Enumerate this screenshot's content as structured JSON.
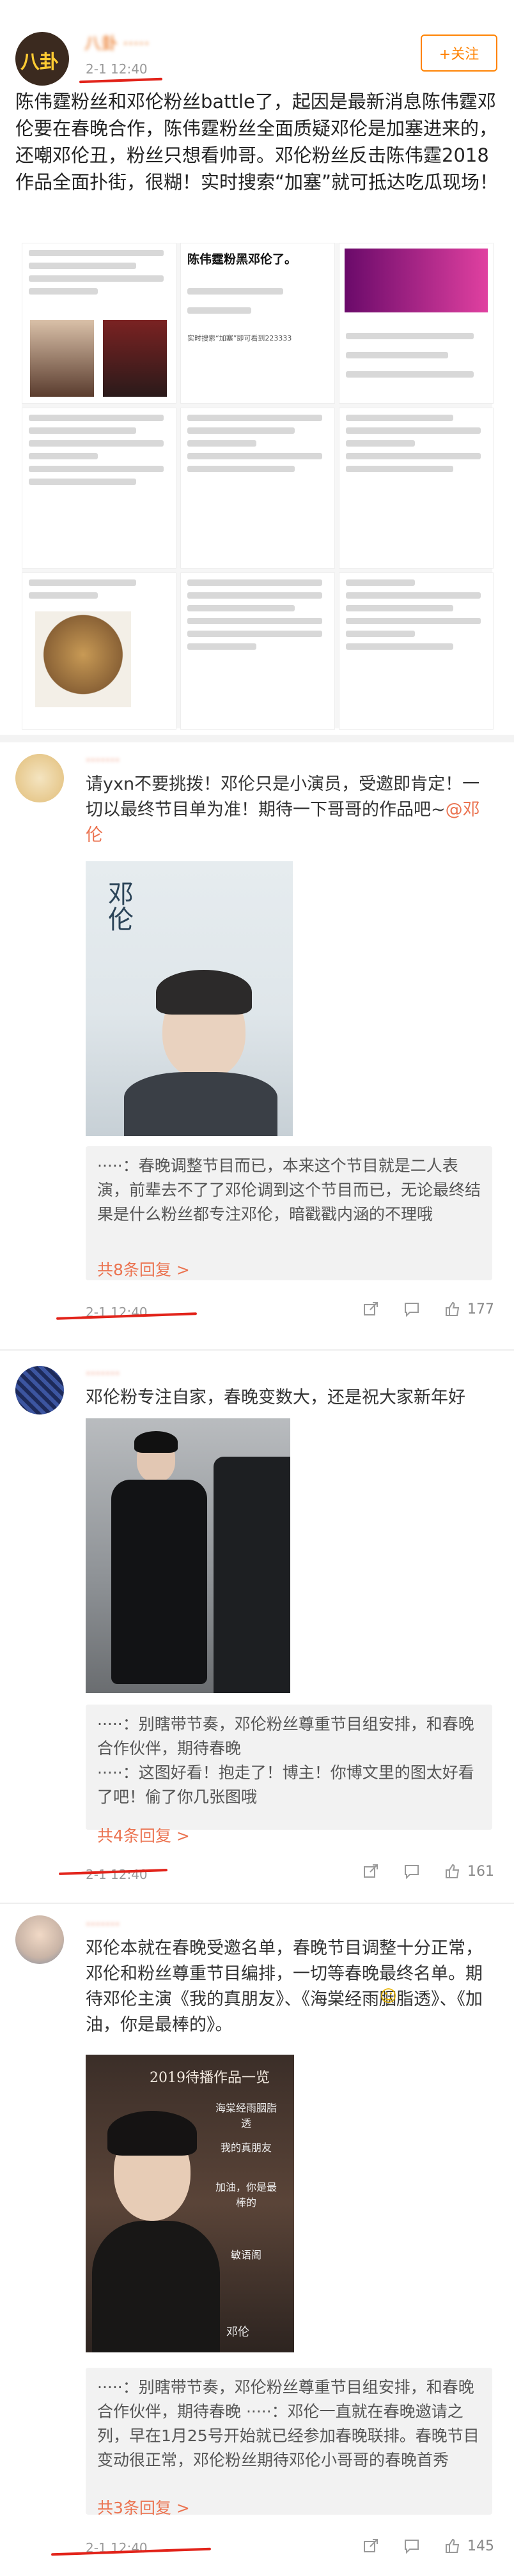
{
  "post": {
    "author_name": "八卦 ·····",
    "avatar_text": "八卦",
    "follow_label": "+关注",
    "time": "2-1 12:40",
    "text": "陈伟霆粉丝和邓伦粉丝battle了，起因是最新消息陈伟霆邓伦要在春晚合作，陈伟霆粉丝全面质疑邓伦是加塞进来的，还嘲邓伦丑，粉丝只想看帅哥。邓伦粉丝反击陈伟霆2018作品全面扑街，很糊！实时搜索“加塞”就可抵达吃瓜现场！",
    "collage": {
      "headline": "陈伟霆粉黑邓伦了。",
      "search_text": "实时搜索“加塞”即可看到223333",
      "mini_title": "陈伟霆粉黑邓伦了。"
    }
  },
  "comments": [
    {
      "name": "·······",
      "text_parts": [
        "请yxn不要挑拨！邓伦只是小演员，受邀即肯定！一切以最终节目单为准！期待一下哥哥的作品吧~",
        "@邓伦"
      ],
      "poster_label": "邓伦",
      "reply_text": "·····：春晚调整节目而已，本来这个节目就是二人表演，前辈去不了了邓伦调到这个节目而已，无论最终结果是什么粉丝都专注邓伦，暗戳戳内涵的不理哦",
      "reply_more": "共8条回复 >",
      "time": "2-1 12:40",
      "likes": "177"
    },
    {
      "name": "·······",
      "text": "邓伦粉专注自家，春晚变数大，还是祝大家新年好",
      "reply_lines": [
        "·····：别瞎带节奏，邓伦粉丝尊重节目组安排，和春晚合作伙伴，期待春晚",
        "·····：这图好看！抱走了！博主！你博文里的图太好看了吧！偷了你几张图哦"
      ],
      "reply_more": "共4条回复 >",
      "time": "2-1 12:40",
      "likes": "161"
    },
    {
      "name": "·······",
      "text": "邓伦本就在春晚受邀名单，春晚节目调整十分正常，邓伦和粉丝尊重节目编排，一切等春晚最终名单。期待邓伦主演《我的真朋友》、《海棠经雨胭脂透》、《加油，你是最棒的》。",
      "poster_title": "2019待播作品一览",
      "poster_lines": [
        "海棠经雨胭脂透",
        "我的真朋友",
        "加油，你是最棒的",
        "敏语阁",
        "邓伦"
      ],
      "reply_text": "·····：别瞎带节奏，邓伦粉丝尊重节目组安排，和春晚合作伙伴，期待春晚 ·····：邓伦一直就在春晚邀请之列，早在1月25号开始就已经参加春晚联排。春晚节目变动很正常，邓伦粉丝期待邓伦小哥哥的春晚首秀",
      "reply_more": "共3条回复 >",
      "time": "2-1 12:40",
      "likes": "145"
    }
  ],
  "icons": {
    "share": "share-icon",
    "comment": "comment-icon",
    "like": "thumbs-up-icon"
  },
  "colors": {
    "accent": "#ff8200",
    "link": "#eb7350",
    "annotation_red": "#e2231a"
  }
}
